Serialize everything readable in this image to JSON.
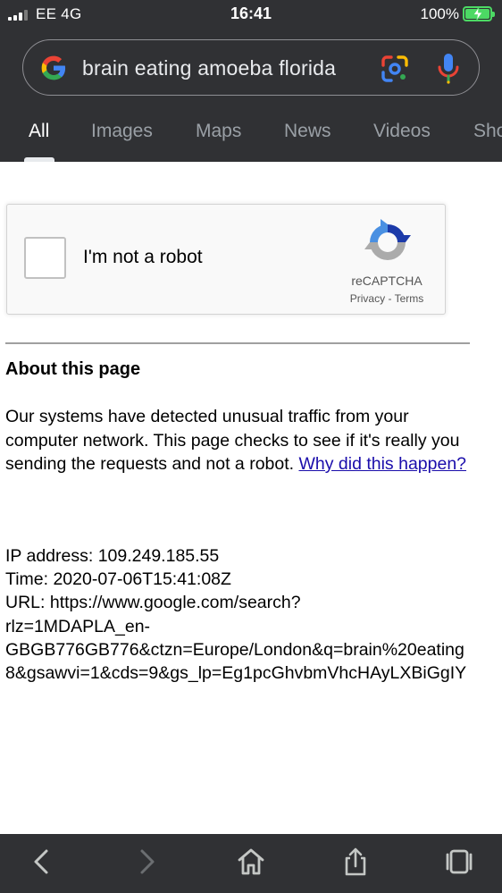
{
  "status_bar": {
    "carrier": "EE  4G",
    "time": "16:41",
    "battery": "100%"
  },
  "search": {
    "query": "brain eating amoeba florida"
  },
  "tabs": [
    {
      "label": "All",
      "active": true
    },
    {
      "label": "Images",
      "active": false
    },
    {
      "label": "Maps",
      "active": false
    },
    {
      "label": "News",
      "active": false
    },
    {
      "label": "Videos",
      "active": false
    },
    {
      "label": "Sho",
      "active": false
    }
  ],
  "recaptcha": {
    "label": "I'm not a robot",
    "brand": "reCAPTCHA",
    "privacy": "Privacy",
    "separator": " - ",
    "terms": "Terms"
  },
  "about": {
    "title": "About this page",
    "body": "Our systems have detected unusual traffic from your computer network. This page checks to see if it's really you sending the requests and not a robot. ",
    "link": "Why did this happen?"
  },
  "info": {
    "ip": "IP address: 109.249.185.55",
    "time": "Time: 2020-07-06T15:41:08Z",
    "url_lines": [
      "URL: https://www.google.com/search?",
      "rlz=1MDAPLA_en-",
      "GBGB776GB776&ctzn=Europe/London&q=brain%20eating",
      "8&gsawvi=1&cds=9&gs_lp=Eg1pcGhvbmVhcHAyLXBiGgIY"
    ]
  },
  "colors": {
    "chrome_bg": "#303134",
    "link": "#1a0dab",
    "battery": "#4cd964"
  },
  "icons": {
    "back": "chevron-left-icon",
    "forward": "chevron-right-icon",
    "home": "home-icon",
    "share": "share-icon",
    "tabs": "tabs-icon"
  }
}
